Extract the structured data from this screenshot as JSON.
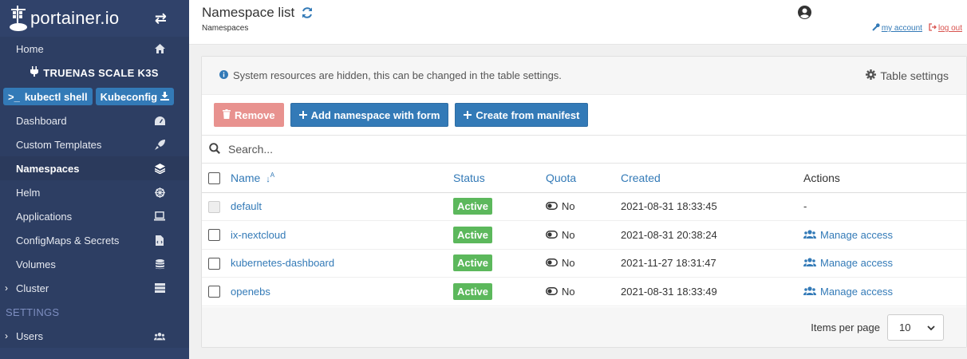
{
  "brand": {
    "name": "portainer.io"
  },
  "sidebar": {
    "home": "Home",
    "environment": "TRUENAS SCALE K3S",
    "kubectl_shell": "kubectl shell",
    "kubeconfig": "Kubeconfig",
    "items": [
      {
        "label": "Dashboard",
        "icon": "tachometer-icon"
      },
      {
        "label": "Custom Templates",
        "icon": "rocket-icon"
      },
      {
        "label": "Namespaces",
        "icon": "layer-group-icon"
      },
      {
        "label": "Helm",
        "icon": "dharmachakra-icon"
      },
      {
        "label": "Applications",
        "icon": "laptop-code-icon"
      },
      {
        "label": "ConfigMaps & Secrets",
        "icon": "file-code-icon"
      },
      {
        "label": "Volumes",
        "icon": "database-icon"
      },
      {
        "label": "Cluster",
        "icon": "server-icon"
      }
    ],
    "settings_section": "SETTINGS",
    "users": "Users"
  },
  "header": {
    "title": "Namespace list",
    "breadcrumb": "Namespaces",
    "my_account": "my account",
    "log_out": "log out"
  },
  "panel": {
    "info": "System resources are hidden, this can be changed in the table settings.",
    "table_settings": "Table settings",
    "remove": "Remove",
    "add_form": "Add namespace with form",
    "create_manifest": "Create from manifest",
    "search_placeholder": "Search..."
  },
  "table": {
    "headers": {
      "name": "Name",
      "status": "Status",
      "quota": "Quota",
      "created": "Created",
      "actions": "Actions"
    },
    "rows": [
      {
        "name": "default",
        "status": "Active",
        "quota": "No",
        "created": "2021-08-31 18:33:45",
        "action": "-"
      },
      {
        "name": "ix-nextcloud",
        "status": "Active",
        "quota": "No",
        "created": "2021-08-31 20:38:24",
        "action": "Manage access"
      },
      {
        "name": "kubernetes-dashboard",
        "status": "Active",
        "quota": "No",
        "created": "2021-11-27 18:31:47",
        "action": "Manage access"
      },
      {
        "name": "openebs",
        "status": "Active",
        "quota": "No",
        "created": "2021-08-31 18:33:49",
        "action": "Manage access"
      }
    ]
  },
  "footer": {
    "items_per_page_label": "Items per page",
    "items_per_page": "10"
  }
}
